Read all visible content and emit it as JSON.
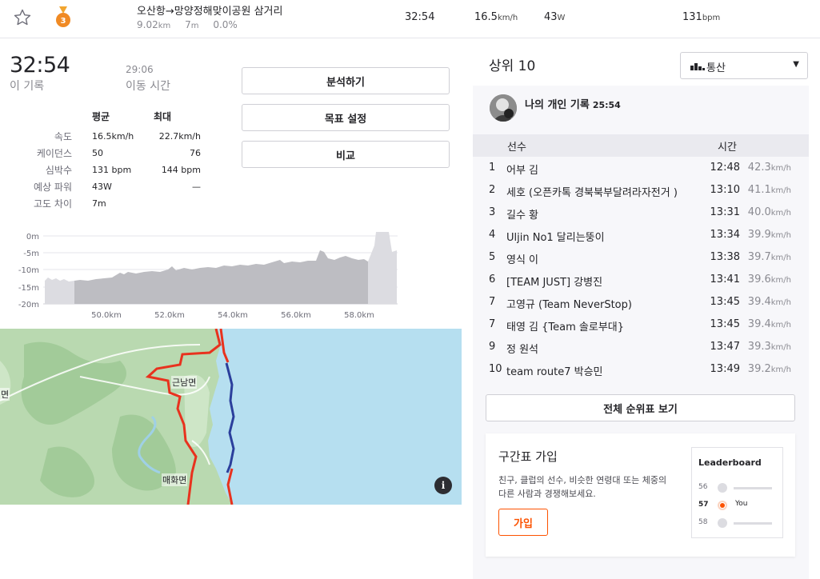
{
  "segment": {
    "name": "오산항→망양정해맞이공원 삼거리",
    "distance": "9.02",
    "distance_unit": "km",
    "elevation": "7",
    "elevation_unit": "m",
    "grade": "0.0%",
    "medal_rank": "3"
  },
  "top_stats": {
    "time": "32:54",
    "speed": "16.5",
    "speed_unit": "km/h",
    "power": "43",
    "power_unit": "W",
    "heart_rate": "131",
    "heart_rate_unit": "bpm"
  },
  "summary": {
    "elapsed": "32:54",
    "elapsed_label": "이 기록",
    "moving": "29:06",
    "moving_label": "이동 시간"
  },
  "stats_table": {
    "col_avg": "평균",
    "col_max": "최대",
    "rows": [
      {
        "label": "속도",
        "avg": "16.5km/h",
        "max": "22.7km/h"
      },
      {
        "label": "케이던스",
        "avg": "50",
        "max": "76"
      },
      {
        "label": "심박수",
        "avg": "131 bpm",
        "max": "144 bpm"
      },
      {
        "label": "예상 파워",
        "avg": "43W",
        "max": "—"
      },
      {
        "label": "고도 차이",
        "avg": "7m",
        "max": ""
      }
    ]
  },
  "actions": {
    "analyze": "분석하기",
    "goal": "목표 설정",
    "compare": "비교"
  },
  "elevation_chart": {
    "y_ticks": [
      "0m",
      "-5m",
      "-10m",
      "-15m",
      "-20m"
    ],
    "x_ticks": [
      "50.0km",
      "52.0km",
      "54.0km",
      "56.0km",
      "58.0km"
    ]
  },
  "map": {
    "labels": [
      "근남면",
      "매화면",
      "면"
    ],
    "info_icon": "info-icon"
  },
  "leaderboard": {
    "title": "상위 10",
    "filter": "통산",
    "pr_label": "나의 개인 기록",
    "pr_time": "25:54",
    "col_athlete": "선수",
    "col_time": "시간",
    "rows": [
      {
        "rank": "1",
        "name": "어부 김",
        "time": "12:48",
        "speed": "42.3",
        "unit": "km/h"
      },
      {
        "rank": "2",
        "name": "세호 (오픈카톡 경북북부달려라자전거 )",
        "time": "13:10",
        "speed": "41.1",
        "unit": "km/h"
      },
      {
        "rank": "3",
        "name": "길수 황",
        "time": "13:31",
        "speed": "40.0",
        "unit": "km/h"
      },
      {
        "rank": "4",
        "name": "Uljin No1 달리는뚱이",
        "time": "13:34",
        "speed": "39.9",
        "unit": "km/h"
      },
      {
        "rank": "5",
        "name": "영식 이",
        "time": "13:38",
        "speed": "39.7",
        "unit": "km/h"
      },
      {
        "rank": "6",
        "name": "[TEAM JUST] 강병진",
        "time": "13:41",
        "speed": "39.6",
        "unit": "km/h"
      },
      {
        "rank": "7",
        "name": "고영규 (Team NeverStop)",
        "time": "13:45",
        "speed": "39.4",
        "unit": "km/h"
      },
      {
        "rank": "7",
        "name": "태영 김 {Team 솔로부대}",
        "time": "13:45",
        "speed": "39.4",
        "unit": "km/h"
      },
      {
        "rank": "9",
        "name": "정 원석",
        "time": "13:47",
        "speed": "39.3",
        "unit": "km/h"
      },
      {
        "rank": "10",
        "name": "team route7 박승민",
        "time": "13:49",
        "speed": "39.2",
        "unit": "km/h"
      }
    ],
    "full_button": "전체 순위표 보기"
  },
  "join_card": {
    "title": "구간표 가입",
    "description": "친구, 클럽의 선수, 비슷한 연령대 또는 체중의 다른 사람과 경쟁해보세요.",
    "button": "가입",
    "mini_title": "Leaderboard",
    "mini_rows": [
      {
        "rank": "56",
        "you": ""
      },
      {
        "rank": "57",
        "you": "You"
      },
      {
        "rank": "58",
        "you": ""
      }
    ]
  },
  "colors": {
    "accent": "#fc5200",
    "route_red": "#e8321e",
    "route_blue": "#2b3f9c",
    "sea": "#b6dff0",
    "land": "#b9d9b0"
  }
}
